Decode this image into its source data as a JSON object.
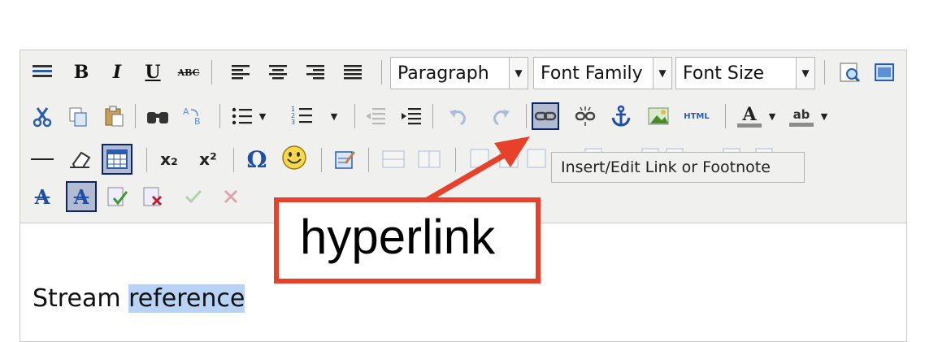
{
  "toolbar": {
    "format_select": "Paragraph",
    "font_family_select": "Font Family",
    "font_size_select": "Font Size",
    "bold_label": "B",
    "italic_label": "I",
    "underline_label": "U",
    "strike_label": "ABC",
    "subscript_label": "x₂",
    "superscript_label": "x²",
    "omega_label": "Ω",
    "html_label": "HTML",
    "font_color_label": "A",
    "highlight_label": "ab"
  },
  "tooltip": {
    "text": "Insert/Edit Link or Footnote"
  },
  "content": {
    "plain": "Stream ",
    "selected": "reference"
  },
  "annotation": {
    "label": "hyperlink",
    "color": "#e8412b"
  },
  "icons": [
    "toolbar-toggle-icon",
    "cut-icon",
    "copy-icon",
    "paste-icon",
    "find-icon",
    "replace-icon",
    "bullet-list-icon",
    "numbered-list-icon",
    "outdent-icon",
    "indent-icon",
    "undo-icon",
    "redo-icon",
    "link-icon",
    "unlink-icon",
    "anchor-icon",
    "image-icon",
    "html-icon",
    "hr-icon",
    "eraser-icon",
    "table-icon",
    "emoji-icon",
    "edit-icon",
    "preview-icon",
    "fullscreen-icon"
  ]
}
